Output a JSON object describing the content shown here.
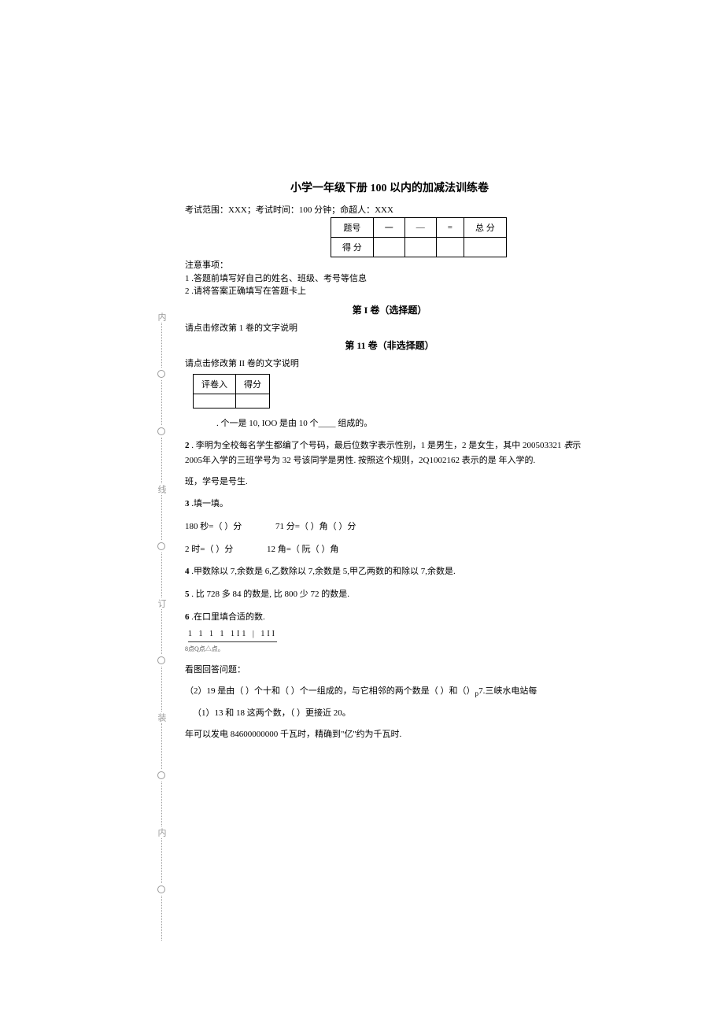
{
  "title": "小学一年级下册 100 以内的加减法训练卷",
  "meta": "考试范围：XXX；考试时间：100 分钟；命超人：XXX",
  "score_table": {
    "headers": [
      "题号",
      "一",
      "—",
      "=",
      "总 分"
    ],
    "row2_label": "得 分"
  },
  "notice": {
    "header": "注意事项：",
    "item1": "1    .答题前填写好自己的姓名、班级、考号等信息",
    "item2": "2    .请将答案正确填写在答题卡上"
  },
  "section1": {
    "header": "第 I 卷（选择题）",
    "instruction": "请点击修改第 1 卷的文字说明"
  },
  "section2": {
    "header": "第 11 卷（非选择题）",
    "instruction": "请点击修改第 II 卷的文字说明",
    "table": {
      "c1": "评卷入",
      "c2": "得分"
    }
  },
  "q1": ". 个一是 10, IOO 是由 10 个____ 组成的。",
  "q2": {
    "num": "2",
    "text1": ". 李明为全校每名学生都编了个号码，最后位数字表示性别，1 是男生，2 是女生，其中 200503321 ",
    "italic": "表",
    "text2": "示 2005年入学的三班学号为 32 号该同学是男性. 按照这个规则，2Q1002162 表示的是 年入学的.",
    "text3": "班，学号是号生."
  },
  "q3": {
    "num": "3",
    "label": ".填一填。",
    "line1a": "180 秒=（     ）分",
    "line1b": "71 分=（     ）角（     ）分",
    "line2a": "2 时=（     ）分",
    "line2b": "12 角=（     阮（     ）角"
  },
  "q4": {
    "num": "4",
    "text": ".甲数除以 7,余数是 6,乙数除以 7,余数是 5,甲乙两数的和除以 7,余数是."
  },
  "q5": {
    "num": "5",
    "text": ". 比 728 多 84 的数是, 比 800 少 72 的数是."
  },
  "q6": {
    "num": "6",
    "text": ".在口里填合适的数.",
    "numline": "1    1    1  1   1I1                   |    1II",
    "sub": "8点Q点△点。"
  },
  "q7": {
    "header": "看图回答问题：",
    "line1": "（2）19 是由（         ）个十和（         ）个一组成的，与它相邻的两个数是（         ）和（）",
    "suffix": "7.三峡水电站每",
    "line2": "（1）13 和 18 这两个数，（      ）更接近 20。",
    "line3": "年可以发电 84600000000 千瓦时，精确到\"亿''约为千瓦时."
  },
  "side_chars": [
    "内",
    "线",
    "订",
    "装",
    "内"
  ]
}
